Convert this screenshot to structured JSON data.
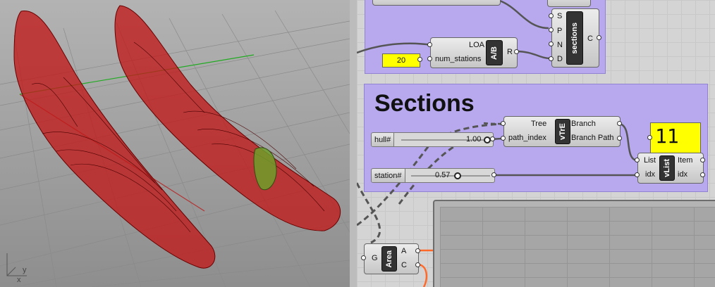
{
  "viewport": {
    "axis_y_label": "y",
    "axis_x_label": "x",
    "colors": {
      "background": "#9d9d9d",
      "hull": "#c21a1a",
      "grid_line": "#8a8a8a",
      "axis_x": "#b33333",
      "axis_y": "#22aa22",
      "section_highlight": "#6f9d2a"
    }
  },
  "top_group": {
    "sections_comp": {
      "inputs": [
        "S",
        "P",
        "N",
        "D"
      ],
      "name": "sections",
      "output": "C"
    },
    "ab_comp": {
      "input_loa": "LOA",
      "input_stations": "num_stations",
      "badge": "A/B",
      "output": "R"
    },
    "stations_value": "20"
  },
  "sections_group": {
    "title": "Sections",
    "hull_slider": {
      "name": "hull#",
      "value": "1.00"
    },
    "station_slider": {
      "name": "station#",
      "value": "0.57"
    },
    "vtree_comp": {
      "input_tree": "Tree",
      "input_path": "path_index",
      "badge": "vTrE",
      "output_branch": "Branch",
      "output_path": "Branch Path"
    },
    "vlist_comp": {
      "input_list": "List",
      "input_idx": "idx",
      "badge": "vList",
      "output_item": "Item",
      "output_idx": "idx"
    },
    "panel_value": "11"
  },
  "area_comp": {
    "input": "G",
    "name": "Area",
    "output_a": "A",
    "output_c": "C"
  },
  "colors": {
    "group_fill": "#b8a8ee",
    "panel_yellow": "#ffff00",
    "wire": "#555555",
    "wire_orange": "#ff6a2a"
  }
}
